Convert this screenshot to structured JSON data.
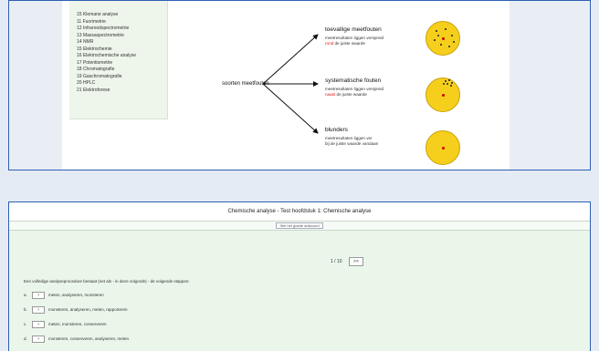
{
  "top_screenshot": {
    "toc_items": [
      "15 Klemane analyse",
      "11 Fuorimetrie",
      "12 Infraroodspectrometrie",
      "13 Massaspectrometrie",
      "14 NMR",
      "15 Elektrochemie",
      "16 Elektrochemische analyse",
      "17 Potentiometrie",
      "18 Chromatografie",
      "19 Gaschromatografie",
      "20 HPLC",
      "21 Elektroforese"
    ],
    "root_label": "soorten meetfouten",
    "errors": [
      {
        "title": "toevallige meetfouten",
        "desc_line1": "meetresultaten liggen verspreid",
        "desc_red": "rond",
        "desc_line2_rest": " de juiste waarde"
      },
      {
        "title": "systematische fouten",
        "desc_line1": "meetresultaten liggen verspreid",
        "desc_red": "naast",
        "desc_line2_rest": " de juiste waarde"
      },
      {
        "title": "blunders",
        "desc_line1": "meetresultaten liggen ver",
        "desc_red": "",
        "desc_line2_rest": "bij de juiste waarde vandaan"
      }
    ]
  },
  "bottom_screenshot": {
    "title": "Chemische analyse - Test hoofdstuk 1: Chemische analyse",
    "link": "Stel het goede antwoord",
    "pager": {
      "position": "1 / 10",
      "next_label": ">>"
    },
    "question": "Een volledige analyseprocedure bestaat (net als - in deze volgorde) - de volgende stappen:",
    "options": [
      {
        "letter": "a.",
        "text": "meten, analyseren, monsteren"
      },
      {
        "letter": "b.",
        "text": "monsteren, analyseren, meten, rapporteren"
      },
      {
        "letter": "c.",
        "text": "meten, monsteren, conserveren"
      },
      {
        "letter": "d.",
        "text": "monsteren, conserveren, analyseren, meten"
      }
    ]
  },
  "colors": {
    "frame": "#2e5fb3",
    "target": "#f5cf1c",
    "highlight": "#d11111",
    "quiz_bg": "#eaf6ea"
  }
}
